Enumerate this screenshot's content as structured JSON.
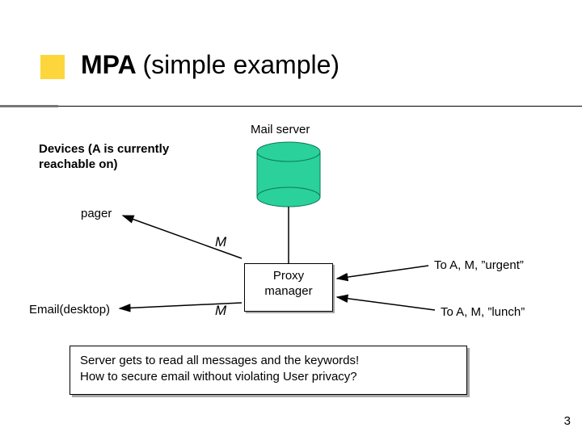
{
  "title": {
    "main": "MPA",
    "sub": "(simple example)"
  },
  "labels": {
    "mail_server": "Mail server",
    "devices_line1": "Devices (A is currently",
    "devices_line2": "reachable on)",
    "pager": "pager",
    "email_desktop": "Email(desktop)",
    "m1": "M",
    "m2": "M",
    "proxy_line1": "Proxy",
    "proxy_line2": "manager",
    "to_urgent": "To A, M, ”urgent”",
    "to_lunch": "To A, M, ”lunch”"
  },
  "callout": {
    "l1": "Server gets to read all messages and the keywords!",
    "l2": "How to secure email without violating User privacy?"
  },
  "slide_number": "3",
  "colors": {
    "cylinder_fill": "#2ad19a",
    "box_border": "#000000",
    "accent_yellow": "#fcd63b"
  }
}
